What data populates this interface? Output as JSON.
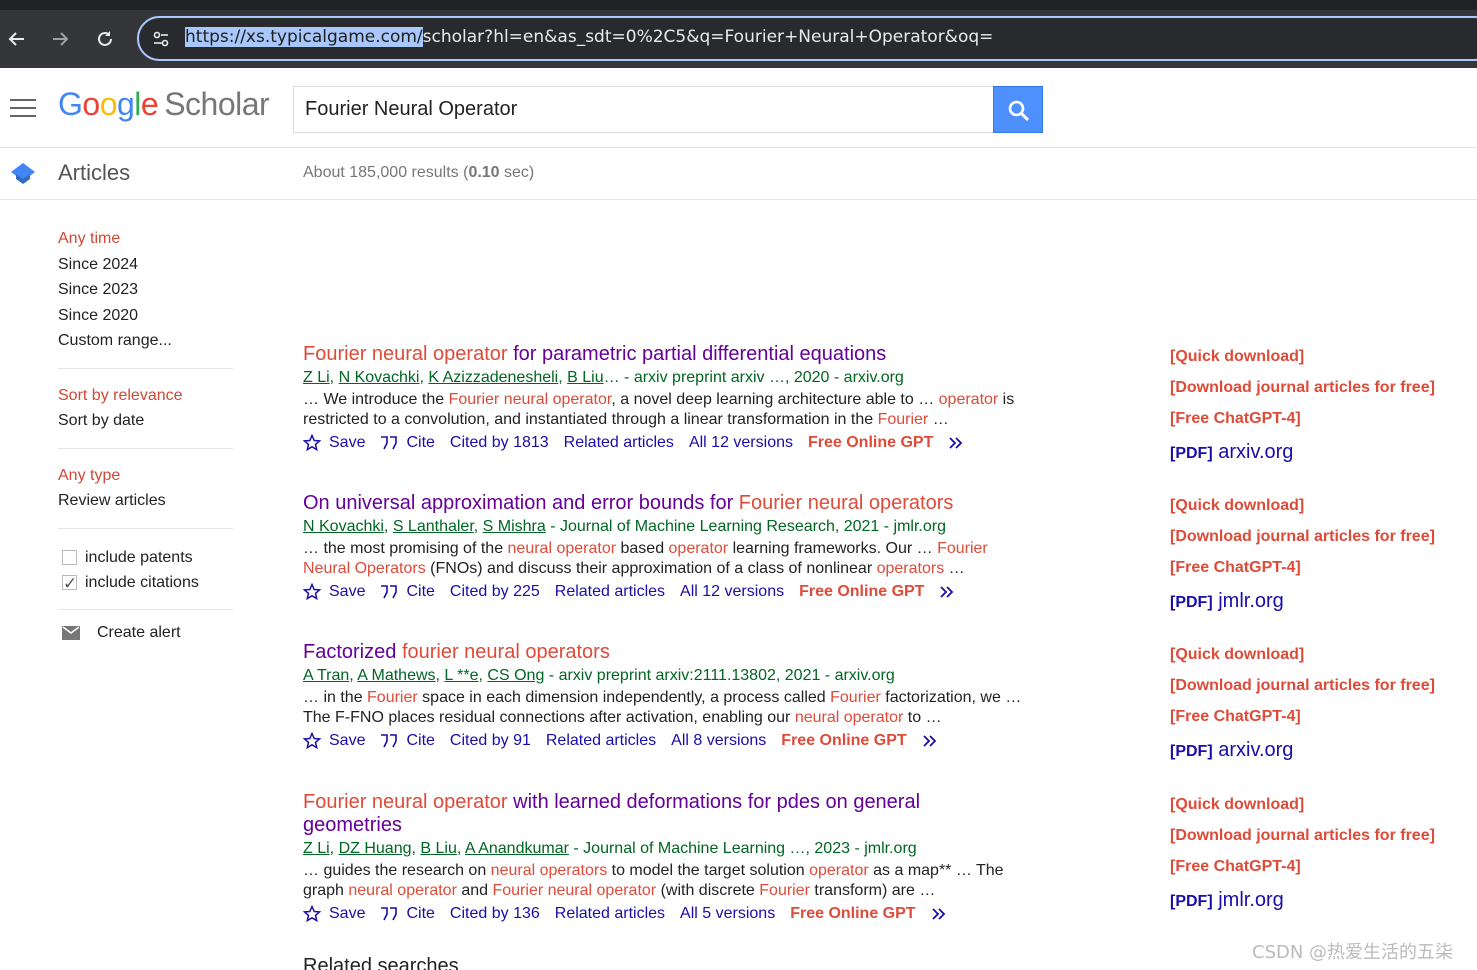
{
  "browser": {
    "url_selected": "https://xs.typicalgame.com/",
    "url_rest": "scholar?hl=en&as_sdt=0%2C5&q=Fourier+Neural+Operator&oq="
  },
  "header": {
    "logo_google": "Google",
    "logo_scholar": "Scholar",
    "search_value": "Fourier Neural Operator"
  },
  "subbar": {
    "articles": "Articles",
    "results_prefix": "About 185,000 results (",
    "results_time": "0.10",
    "results_suffix": " sec)"
  },
  "sidebar": {
    "time": [
      "Any time",
      "Since 2024",
      "Since 2023",
      "Since 2020",
      "Custom range..."
    ],
    "sort": [
      "Sort by relevance",
      "Sort by date"
    ],
    "type": [
      "Any type",
      "Review articles"
    ],
    "include_patents": "include patents",
    "include_citations": "include citations",
    "create_alert": "Create alert"
  },
  "results": [
    {
      "title_hl": "Fourier neural operator",
      "title_rest": " for parametric partial differential equations",
      "authors": [
        "Z Li",
        "N Kovachki",
        "K Azizzadenesheli",
        "B Liu"
      ],
      "source": "… - arxiv preprint arxiv …, 2020 - arxiv.org",
      "snippet": [
        {
          "t": "… We introduce the "
        },
        {
          "t": "Fourier neural operator",
          "h": true
        },
        {
          "t": ", a novel deep learning architecture able to … "
        },
        {
          "t": "operator",
          "h": true
        },
        {
          "t": " is restricted to a convolution, and instantiated through a linear transformation in the "
        },
        {
          "t": "Fourier",
          "h": true
        },
        {
          "t": " …"
        }
      ],
      "save": "Save",
      "cite": "Cite",
      "cited_by": "Cited by 1813",
      "related": "Related articles",
      "versions": "All 12 versions",
      "gpt": "Free Online GPT",
      "quick": "[Quick download]",
      "journal": "[Download journal articles for free]",
      "chatgpt": "[Free ChatGPT-4]",
      "pdf_tag": "[PDF]",
      "pdf_site": "arxiv.org"
    },
    {
      "title_pre": "On universal approximation and error bounds for ",
      "title_hl": "Fourier neural operators",
      "authors": [
        "N Kovachki",
        "S Lanthaler",
        "S Mishra"
      ],
      "source": "- Journal of Machine Learning Research, 2021 - jmlr.org",
      "snippet": [
        {
          "t": "… the most promising of the "
        },
        {
          "t": "neural operator",
          "h": true
        },
        {
          "t": " based "
        },
        {
          "t": "operator",
          "h": true
        },
        {
          "t": " learning frameworks. Our … "
        },
        {
          "t": "Fourier Neural Operators",
          "h": true
        },
        {
          "t": " (FNOs) and discuss their approximation of a class of nonlinear "
        },
        {
          "t": "operators",
          "h": true
        },
        {
          "t": " …"
        }
      ],
      "save": "Save",
      "cite": "Cite",
      "cited_by": "Cited by 225",
      "related": "Related articles",
      "versions": "All 12 versions",
      "gpt": "Free Online GPT",
      "quick": "[Quick download]",
      "journal": "[Download journal articles for free]",
      "chatgpt": "[Free ChatGPT-4]",
      "pdf_tag": "[PDF]",
      "pdf_site": "jmlr.org"
    },
    {
      "title_pre": "Factorized ",
      "title_hl": "fourier neural operators",
      "authors": [
        "A Tran",
        "A Mathews",
        "L **e",
        "CS Ong"
      ],
      "source": "- arxiv preprint arxiv:2111.13802, 2021 - arxiv.org",
      "snippet": [
        {
          "t": "… in the "
        },
        {
          "t": "Fourier",
          "h": true
        },
        {
          "t": " space in each dimension independently, a process called "
        },
        {
          "t": "Fourier",
          "h": true
        },
        {
          "t": " factorization,"
        },
        {
          "t": " we … The F-FNO places residual connections after activation, enabling our "
        },
        {
          "t": "neural operator",
          "h": true
        },
        {
          "t": " to …"
        }
      ],
      "save": "Save",
      "cite": "Cite",
      "cited_by": "Cited by 91",
      "related": "Related articles",
      "versions": "All 8 versions",
      "gpt": "Free Online GPT",
      "quick": "[Quick download]",
      "journal": "[Download journal articles for free]",
      "chatgpt": "[Free ChatGPT-4]",
      "pdf_tag": "[PDF]",
      "pdf_site": "arxiv.org"
    },
    {
      "title_hl": "Fourier neural operator",
      "title_rest": " with learned deformations for pdes on general geometries",
      "authors": [
        "Z Li",
        "DZ Huang",
        "B Liu",
        "A Anandkumar"
      ],
      "source": "- Journal of Machine Learning …, 2023 - jmlr.org",
      "snippet": [
        {
          "t": "… guides the research on "
        },
        {
          "t": "neural operators",
          "h": true
        },
        {
          "t": " to model the target solution "
        },
        {
          "t": "operator",
          "h": true
        },
        {
          "t": " as a map**"
        },
        {
          "t": " … The graph "
        },
        {
          "t": "neural operator",
          "h": true
        },
        {
          "t": " and "
        },
        {
          "t": "Fourier neural operator",
          "h": true
        },
        {
          "t": " (with discrete "
        },
        {
          "t": "Fourier",
          "h": true
        },
        {
          "t": " transform) are …"
        }
      ],
      "save": "Save",
      "cite": "Cite",
      "cited_by": "Cited by 136",
      "related": "Related articles",
      "versions": "All 5 versions",
      "gpt": "Free Online GPT",
      "quick": "[Quick download]",
      "journal": "[Download journal articles for free]",
      "chatgpt": "[Free ChatGPT-4]",
      "pdf_tag": "[PDF]",
      "pdf_site": "jmlr.org"
    }
  ],
  "related_searches": "Related searches",
  "watermark": "CSDN @热爱生活的五柒"
}
